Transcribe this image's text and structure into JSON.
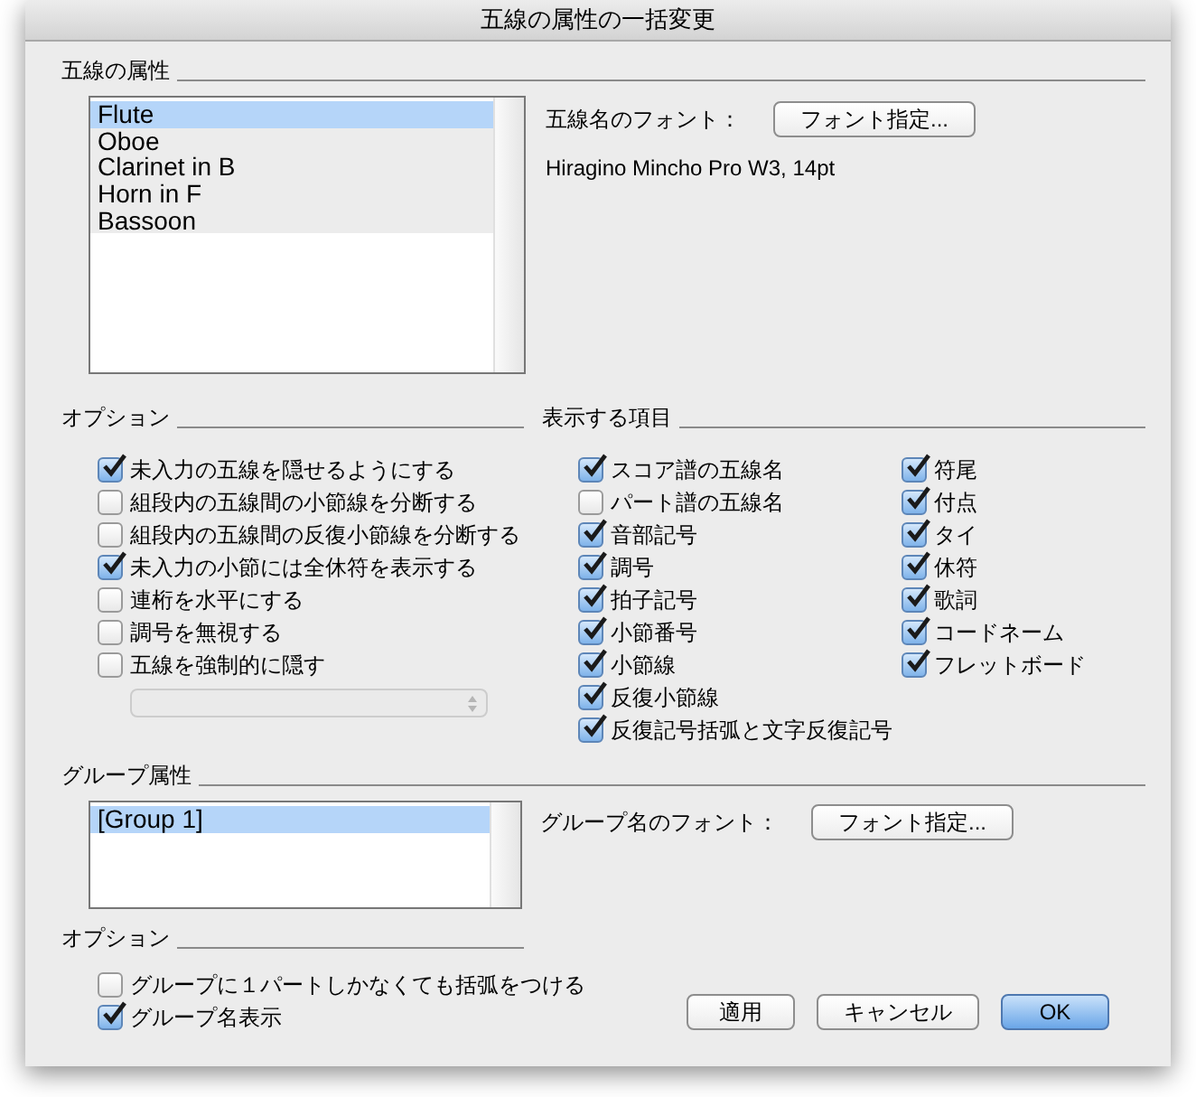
{
  "window": {
    "title": "五線の属性の一括変更"
  },
  "staff_attributes": {
    "heading": "五線の属性",
    "staves": [
      {
        "label": "Flute",
        "selected": true
      },
      {
        "label": "Oboe",
        "selected": false
      },
      {
        "label": "Clarinet in B",
        "selected": false
      },
      {
        "label": "Horn in F",
        "selected": false
      },
      {
        "label": "Bassoon",
        "selected": false
      }
    ],
    "font_label": "五線名のフォント：",
    "font_button": "フォント指定...",
    "font_value": "Hiragino Mincho Pro W3, 14pt"
  },
  "options": {
    "heading": "オプション",
    "items": [
      {
        "label": "未入力の五線を隠せるようにする",
        "checked": true
      },
      {
        "label": "組段内の五線間の小節線を分断する",
        "checked": false
      },
      {
        "label": "組段内の五線間の反復小節線を分断する",
        "checked": false
      },
      {
        "label": "未入力の小節には全休符を表示する",
        "checked": true
      },
      {
        "label": "連桁を水平にする",
        "checked": false
      },
      {
        "label": "調号を無視する",
        "checked": false
      },
      {
        "label": "五線を強制的に隠す",
        "checked": false
      }
    ],
    "popup": {
      "disabled": true
    }
  },
  "display_items": {
    "heading": "表示する項目",
    "column_1": [
      {
        "label": "スコア譜の五線名",
        "checked": true
      },
      {
        "label": "パート譜の五線名",
        "checked": false
      },
      {
        "label": "音部記号",
        "checked": true
      },
      {
        "label": "調号",
        "checked": true
      },
      {
        "label": "拍子記号",
        "checked": true
      },
      {
        "label": "小節番号",
        "checked": true
      },
      {
        "label": "小節線",
        "checked": true
      },
      {
        "label": "反復小節線",
        "checked": true
      },
      {
        "label": "反復記号括弧と文字反復記号",
        "checked": true
      }
    ],
    "column_2": [
      {
        "label": "符尾",
        "checked": true
      },
      {
        "label": "付点",
        "checked": true
      },
      {
        "label": "タイ",
        "checked": true
      },
      {
        "label": "休符",
        "checked": true
      },
      {
        "label": "歌詞",
        "checked": true
      },
      {
        "label": "コードネーム",
        "checked": true
      },
      {
        "label": "フレットボード",
        "checked": true
      }
    ]
  },
  "group_attributes": {
    "heading": "グループ属性",
    "groups": [
      {
        "label": "[Group 1]",
        "selected": true
      }
    ],
    "font_label": "グループ名のフォント：",
    "font_button": "フォント指定..."
  },
  "group_options": {
    "heading": "オプション",
    "items": [
      {
        "label": "グループに１パートしかなくても括弧をつける",
        "checked": false
      },
      {
        "label": "グループ名表示",
        "checked": true
      }
    ]
  },
  "buttons": [
    {
      "label": "適用",
      "default": false
    },
    {
      "label": "キャンセル",
      "default": false
    },
    {
      "label": "OK",
      "default": true
    }
  ]
}
